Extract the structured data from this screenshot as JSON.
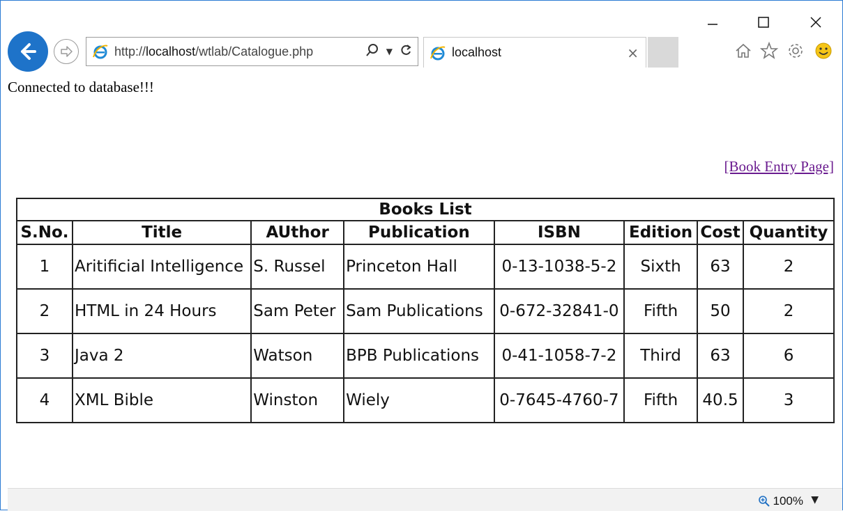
{
  "window": {
    "minimize_icon": "minimize-icon",
    "maximize_icon": "maximize-icon",
    "close_icon": "close-icon"
  },
  "toolbar": {
    "url_prefix": "http://",
    "url_host": "localhost",
    "url_path": "/wtlab/Catalogue.php",
    "tab_title": "localhost",
    "tab_close": "×"
  },
  "page": {
    "status_message": "Connected to database!!!",
    "entry_link": "[Book Entry Page]"
  },
  "table": {
    "caption": "Books List",
    "headers": [
      "S.No.",
      "Title",
      "AUthor",
      "Publication",
      "ISBN",
      "Edition",
      "Cost",
      "Quantity"
    ],
    "rows": [
      [
        "1",
        "Aritificial Intelligence",
        "S. Russel",
        "Princeton Hall",
        "0-13-1038-5-2",
        "Sixth",
        "63",
        "2"
      ],
      [
        "2",
        "HTML in 24 Hours",
        "Sam Peter",
        "Sam Publications",
        "0-672-32841-0",
        "Fifth",
        "50",
        "2"
      ],
      [
        "3",
        "Java 2",
        "Watson",
        "BPB Publications",
        "0-41-1058-7-2",
        "Third",
        "63",
        "6"
      ],
      [
        "4",
        "XML Bible",
        "Winston",
        "Wiely",
        "0-7645-4760-7",
        "Fifth",
        "40.5",
        "3"
      ]
    ]
  },
  "statusbar": {
    "zoom": "100%"
  }
}
